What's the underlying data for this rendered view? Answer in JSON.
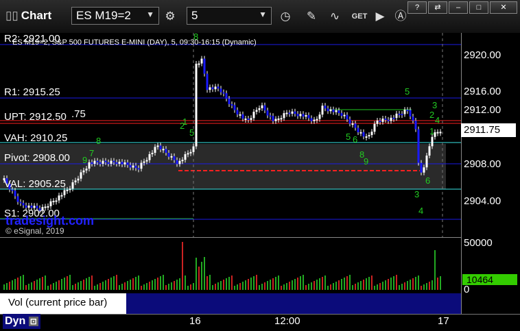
{
  "toolbar": {
    "title": "Chart",
    "symbol": "ES M19=2",
    "interval": "5",
    "get_label": "GET"
  },
  "chart": {
    "header": "ES M19=2, S&P 500 FUTURES E-MINI (DAY), 5, 09:30-16:15 (Dynamic)",
    "copyright": "© eSignal, 2019",
    "watermark": "tradesight.com",
    "levels": {
      "r2": "R2: 2921.00",
      "r1": "R1: 2915.25",
      "upt": "UPT: 2912.50",
      "upt_tail": ".75",
      "vah": "VAH: 2910.25",
      "pivot": "Pivot: 2908.00",
      "val": "VAL: 2905.25",
      "s1": "S1: 2902.00"
    },
    "current_price": "2911.75"
  },
  "price_axis": {
    "ticks": [
      "2920.00",
      "2916.00",
      "2912.00",
      "2908.00",
      "2904.00"
    ]
  },
  "volume": {
    "panel_label": "Vol (current price bar)",
    "close_glyph": "×",
    "ticks": [
      "50000",
      "0"
    ],
    "current": "10464"
  },
  "time_axis": {
    "labels": [
      "16",
      "12:00",
      "17"
    ]
  },
  "bottom": {
    "dyn": "Dyn"
  },
  "colors": {
    "up_candle": "#ffffff",
    "down_candle": "#1a1aff",
    "level_line": "#1a1ae6",
    "cyan_line": "#39e6e6",
    "red_line": "#ff2020",
    "green_text": "#22cc22",
    "axis_bg": "#000000"
  }
}
